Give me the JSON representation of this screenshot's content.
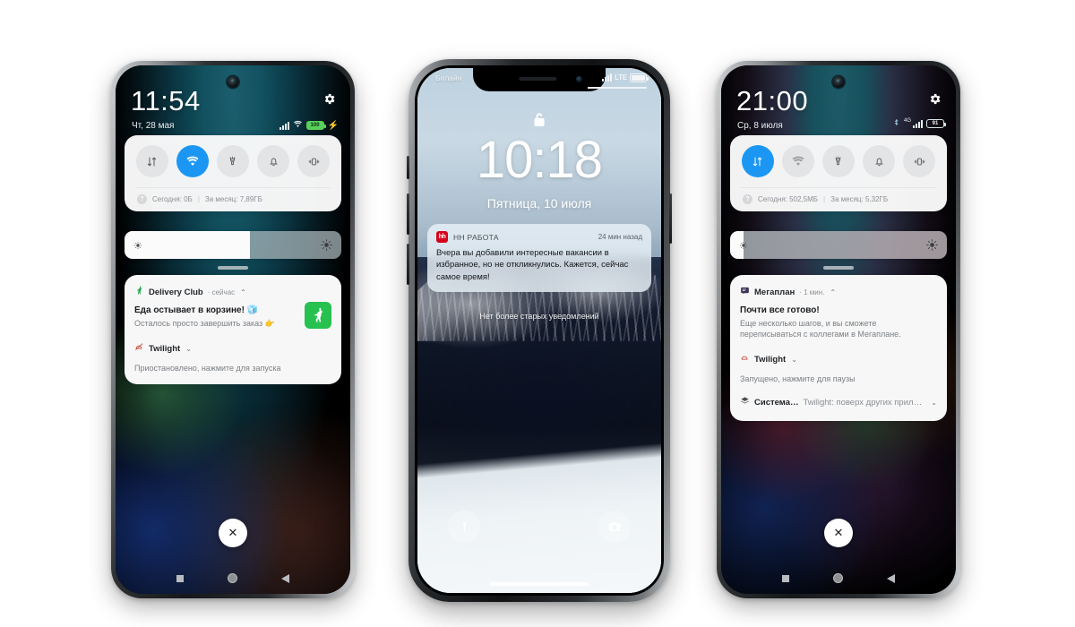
{
  "phone1": {
    "status": {
      "time": "11:54",
      "date": "Чт, 28 мая",
      "battery": "100",
      "charging_icon": "⚡"
    },
    "quick_settings": {
      "tiles": [
        {
          "name": "mobile-data",
          "active": false
        },
        {
          "name": "wifi",
          "active": true
        },
        {
          "name": "flashlight",
          "active": false
        },
        {
          "name": "sound",
          "active": false
        },
        {
          "name": "vibrate",
          "active": false
        }
      ],
      "data_today_label": "Сегодня: 0Б",
      "data_sep": "|",
      "data_month_label": "За месяц: 7,89ГБ",
      "brightness_percent": 58
    },
    "notifications": [
      {
        "app": "Delivery Club",
        "time": "сейчас",
        "chevron": "⌃",
        "title": "Еда остывает в корзине! 🧊",
        "body": "Осталось просто завершить заказ 👉",
        "has_thumb": true
      },
      {
        "app": "Twilight",
        "time": "",
        "chevron": "⌄",
        "title": "",
        "body": "Приостановлено, нажмите для запуска",
        "has_thumb": false
      }
    ],
    "close_label": "✕"
  },
  "phone2": {
    "status": {
      "carrier": "Билайн",
      "network": "LTE"
    },
    "lock": {
      "time": "10:18",
      "date": "Пятница, 10 июля"
    },
    "notification": {
      "icon_text": "hh",
      "app": "HH РАБОТА",
      "time": "24 мин назад",
      "body": "Вчера вы добавили интересные вакансии в избранное, но не откликнулись. Кажется, сейчас самое время!"
    },
    "no_older_text": "Нет более старых уведомлений",
    "shortcuts": [
      {
        "name": "flashlight",
        "label": "Фонарик"
      },
      {
        "name": "camera",
        "label": "Камера"
      }
    ]
  },
  "phone3": {
    "status": {
      "time": "21:00",
      "date": "Ср, 8 июля",
      "battery": "91"
    },
    "quick_settings": {
      "tiles": [
        {
          "name": "mobile-data",
          "active": true
        },
        {
          "name": "wifi",
          "active": false
        },
        {
          "name": "flashlight",
          "active": false
        },
        {
          "name": "sound",
          "active": false
        },
        {
          "name": "vibrate",
          "active": false
        }
      ],
      "data_today_label": "Сегодня: 502,5МБ",
      "data_sep": "|",
      "data_month_label": "За месяц: 5,32ГБ",
      "brightness_percent": 6
    },
    "notifications": [
      {
        "app": "Мегаплан",
        "time": "1 мин.",
        "chevron": "⌃",
        "title": "Почти все готово!",
        "body": "Еще несколько шагов, и вы сможете переписываться с коллегами в Мегаплане.",
        "has_thumb": false
      },
      {
        "app": "Twilight",
        "time": "",
        "chevron": "⌄",
        "title": "",
        "body": "Запущено, нажмите для паузы",
        "has_thumb": false
      }
    ],
    "system_row": {
      "name": "Система…",
      "text": "Twilight: поверх других прило…",
      "chevron": "⌄"
    },
    "close_label": "✕"
  },
  "colors": {
    "accent_blue": "#1b97f3",
    "tile_off": "#e3e4e6",
    "card_bg": "#f7f7f7",
    "dc_green": "#26c14f",
    "hh_red": "#d6001c",
    "battery_green": "#59d05a"
  }
}
